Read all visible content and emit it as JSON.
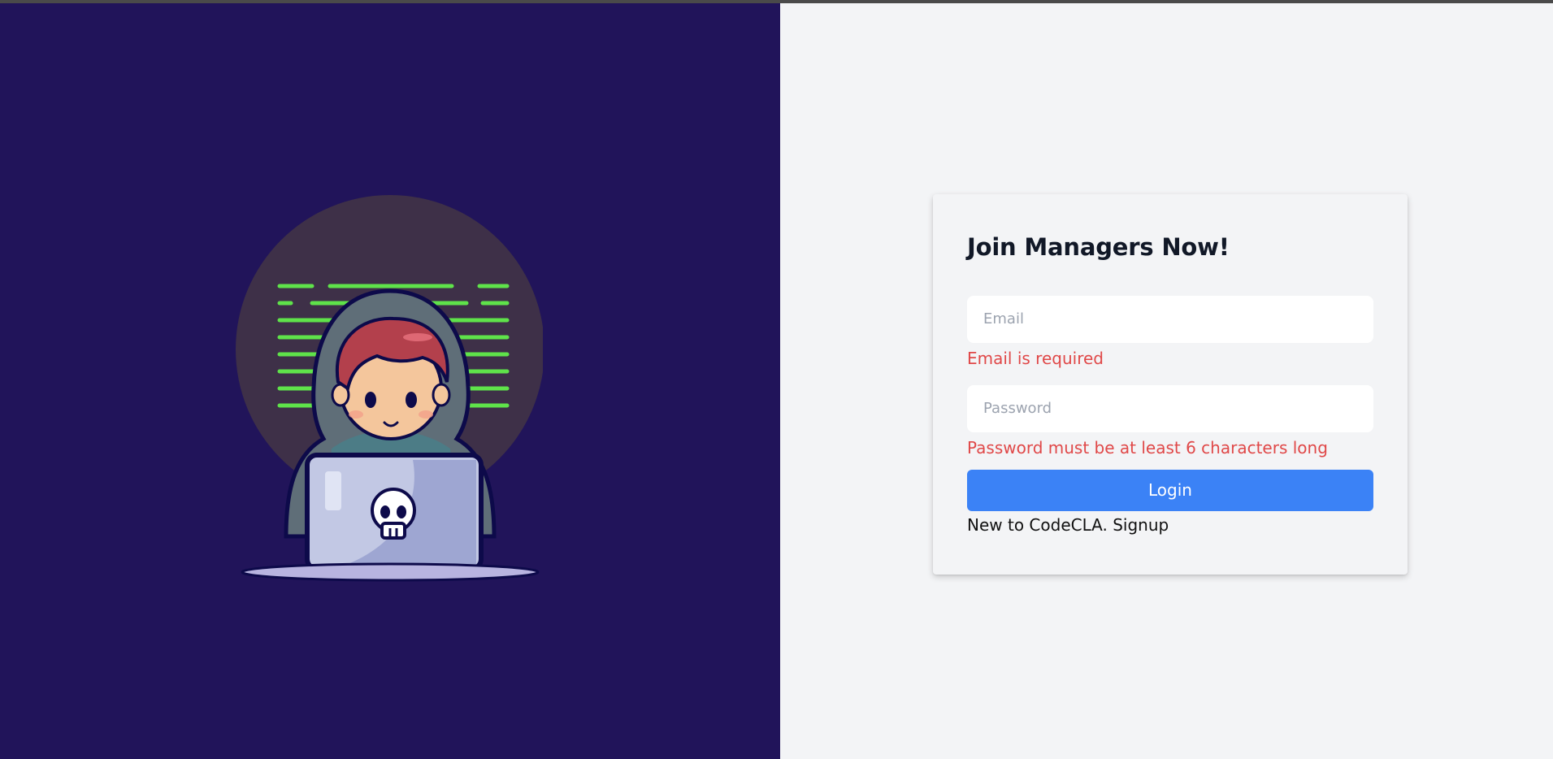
{
  "form": {
    "title": "Join Managers Now!",
    "email_placeholder": "Email",
    "email_value": "",
    "email_error": "Email is required",
    "password_placeholder": "Password",
    "password_value": "",
    "password_error": "Password must be at least 6 characters long",
    "login_label": "Login",
    "signup_prefix": "New to CodeCLA. ",
    "signup_link": "Signup"
  },
  "colors": {
    "left_background": "#21145a",
    "right_background": "#f3f4f6",
    "accent": "#3b82f6",
    "error": "#e04848"
  },
  "icons": {
    "illustration": "hacker-with-laptop-illustration",
    "skull": "skull-icon"
  }
}
